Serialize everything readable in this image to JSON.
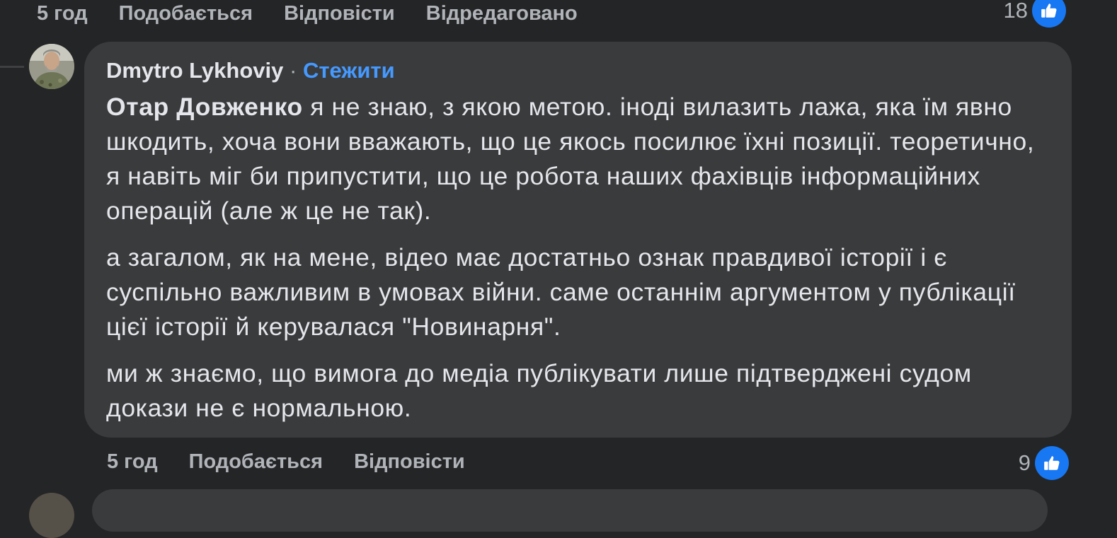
{
  "top_actions": {
    "time": "5 год",
    "like": "Подобається",
    "reply": "Відповісти",
    "edited": "Відредаговано",
    "reaction_count": "18"
  },
  "comment": {
    "author": "Dmytro Lykhoviy",
    "separator": "·",
    "follow": "Стежити",
    "mention": "Отар Довженко",
    "paragraph1_rest": " я не знаю, з якою метою. іноді вилазить лажа, яка їм явно шкодить, хоча вони вважають, що це якось посилює їхні позиції. теоретично, я навіть міг би припустити, що це робота наших фахівців інформаційних операцій (але ж це не так).",
    "paragraph2": "а загалом, як на мене, відео має достатньо ознак правдивої історії і є суспільно важливим в умовах війни. саме останнім аргументом у публікації цієї історії й керувалася \"Новинарня\".",
    "paragraph3": "ми ж знаємо, що вимога до медіа публікувати лише підтверджені судом докази не є нормальною."
  },
  "bottom_actions": {
    "time": "5 год",
    "like": "Подобається",
    "reply": "Відповісти",
    "reaction_count": "9"
  },
  "colors": {
    "background": "#242526",
    "bubble": "#3a3b3c",
    "text": "#e4e6eb",
    "secondary_text": "#b0b3b8",
    "follow_link": "#4599ff",
    "like_badge": "#1877f2"
  },
  "icons": {
    "reaction": "thumbs-up-icon"
  }
}
